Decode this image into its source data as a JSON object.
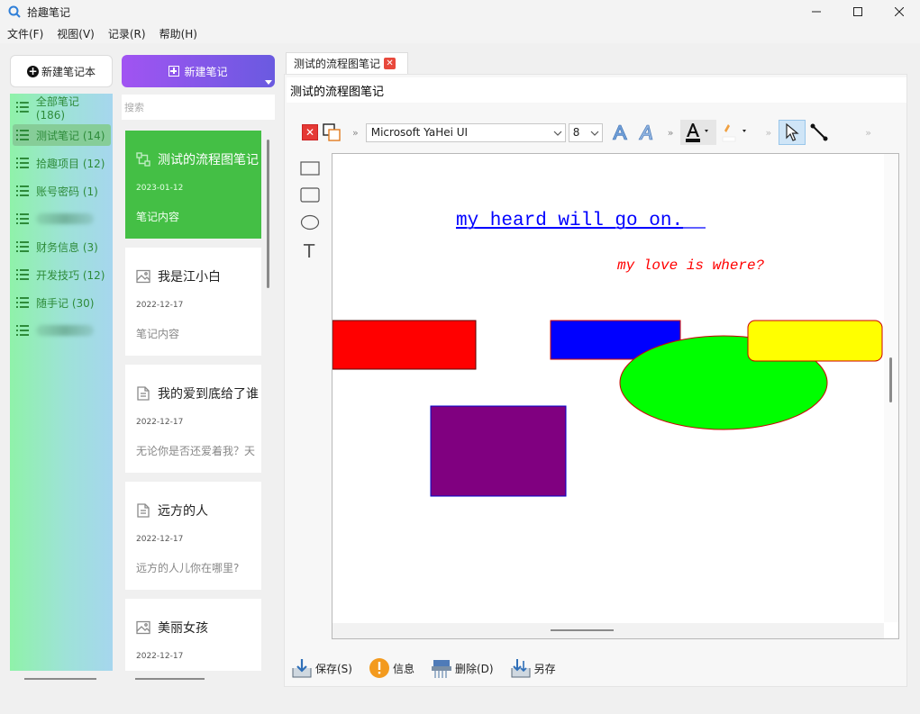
{
  "window": {
    "title": "拾趣笔记"
  },
  "menu": [
    "文件(F)",
    "视图(V)",
    "记录(R)",
    "帮助(H)"
  ],
  "sidebar": {
    "new_notebook_label": "新建笔记本",
    "items": [
      {
        "label": "全部笔记 (186)"
      },
      {
        "label": "测试笔记 (14)"
      },
      {
        "label": "拾趣项目 (12)"
      },
      {
        "label": "账号密码 (1)"
      },
      {
        "label": ""
      },
      {
        "label": "财务信息 (3)"
      },
      {
        "label": "开发技巧 (12)"
      },
      {
        "label": "随手记 (30)"
      },
      {
        "label": ""
      }
    ]
  },
  "notes": {
    "new_note_label": "新建笔记",
    "search_placeholder": "搜索",
    "items": [
      {
        "title": "测试的流程图笔记",
        "date": "2023-01-12",
        "body": "笔记内容",
        "icon": "flowchart-icon"
      },
      {
        "title": "我是江小白",
        "date": "2022-12-17",
        "body": "笔记内容",
        "icon": "image-icon"
      },
      {
        "title": "我的爱到底给了谁",
        "date": "2022-12-17",
        "body": "无论你是否还爱着我？天",
        "icon": "document-icon"
      },
      {
        "title": "远方的人",
        "date": "2022-12-17",
        "body": "远方的人儿你在哪里?",
        "icon": "document-icon"
      },
      {
        "title": "美丽女孩",
        "date": "2022-12-17",
        "body": "",
        "icon": "image-icon"
      }
    ]
  },
  "editor": {
    "tab_label": "测试的流程图笔记",
    "note_title": "测试的流程图笔记",
    "font_family_value": "Microsoft YaHei UI",
    "font_size_value": "8",
    "canvas": {
      "text1": "my heard will go on.",
      "text2": "my love is where?",
      "colors": {
        "red": "#ff0000",
        "blue": "#0000ff",
        "green": "#00ff00",
        "yellow": "#ffff00",
        "purple": "#800080",
        "text1": "#0000ff",
        "text2": "#ff0000"
      }
    }
  },
  "actions": {
    "save": "保存(S)",
    "info": "信息",
    "delete": "删除(D)",
    "save_as": "另存"
  }
}
